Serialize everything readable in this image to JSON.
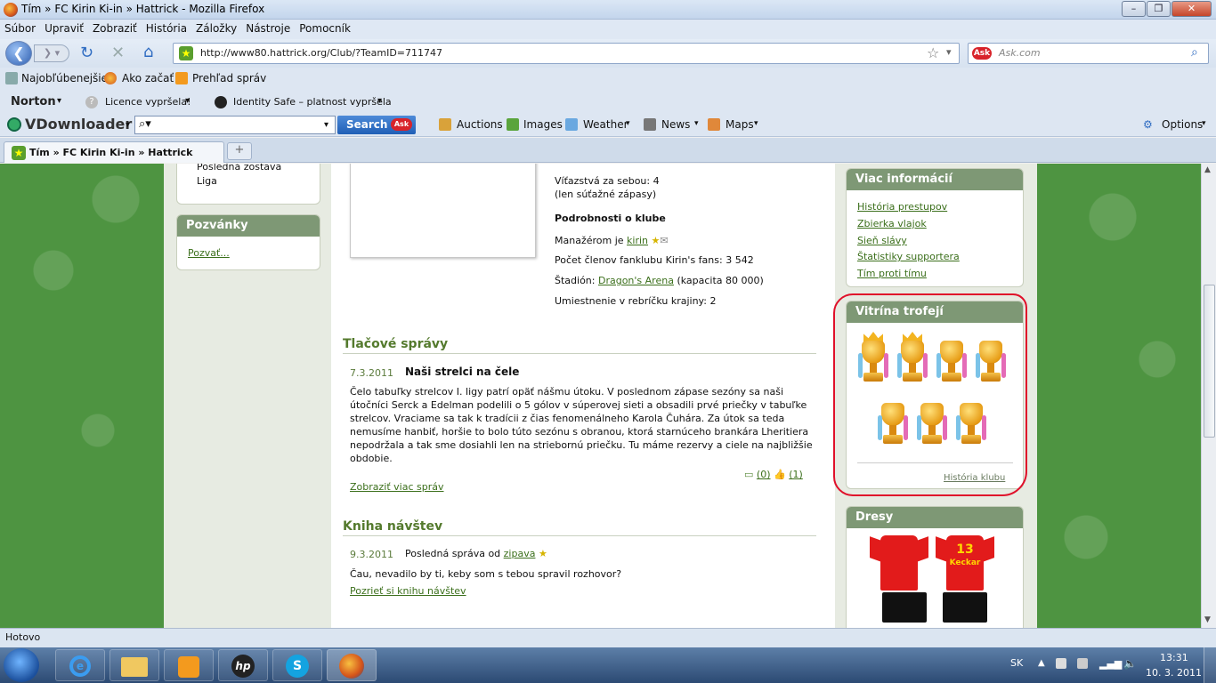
{
  "window": {
    "title": "Tím » FC Kirin Ki-in » Hattrick - Mozilla Firefox"
  },
  "menu": [
    "Súbor",
    "Upraviť",
    "Zobraziť",
    "História",
    "Záložky",
    "Nástroje",
    "Pomocník"
  ],
  "nav": {
    "url": "http://www80.hattrick.org/Club/?TeamID=711747",
    "search_placeholder": "Ask.com"
  },
  "bookmarks": [
    {
      "label": "Najobľúbenejšie"
    },
    {
      "label": "Ako začať"
    },
    {
      "label": "Prehľad správ"
    }
  ],
  "norton": {
    "brand": "Norton",
    "licence": "Licence vypršela!",
    "identity": "Identity Safe – platnost vypršela"
  },
  "vdl": {
    "brand": "VDownloader",
    "search_btn": "Search",
    "items": [
      "Auctions",
      "Images",
      "Weather",
      "News",
      "Maps"
    ],
    "options": "Options"
  },
  "tab": {
    "label": "Tím » FC Kirin Ki-in » Hattrick"
  },
  "left": {
    "top_items": [
      "Posledná zostava",
      "Liga"
    ],
    "invites_title": "Pozvánky",
    "invite_link": "Pozvať..."
  },
  "club": {
    "wins_streak": "Víťazstvá za sebou: 4",
    "wins_note": "(len súťažné zápasy)",
    "details_title": "Podrobnosti o klube",
    "manager_prefix": "Manažérom je",
    "manager": "kirin",
    "fans": "Počet členov fanklubu Kirin's fans: 3 542",
    "stadium_prefix": "Štadión:",
    "stadium": "Dragon's Arena",
    "stadium_cap": "(kapacita 80 000)",
    "ranking": "Umiestnenie v rebríčku krajiny: 2"
  },
  "press": {
    "title": "Tlačové správy",
    "date": "7.3.2011",
    "headline": "Naši strelci na čele",
    "body": "Čelo tabuľky strelcov I. ligy patrí opäť nášmu útoku. V poslednom zápase sezóny sa naši útočníci Serck a Edelman podelili o 5 gólov v súperovej sieti a obsadili prvé priečky v tabuľke strelcov. Vraciame sa tak k tradícii z čias fenomenálneho Karola Čuhára. Za útok sa teda nemusíme hanbiť, horšie to bolo túto sezónu s obranou, ktorá starnúceho brankára Lheritiera nepodržala a tak sme dosiahli len na striebornú priečku. Tu máme rezervy a ciele na najbližšie obdobie.",
    "comments": "(0)",
    "likes": "(1)",
    "more": "Zobraziť viac správ"
  },
  "guestbook": {
    "title": "Kniha návštev",
    "date": "9.3.2011",
    "msg_prefix": "Posledná správa od",
    "user": "zipava",
    "message": "Čau, nevadilo by ti, keby som s tebou spravil rozhovor?",
    "more": "Pozrieť si knihu návštev"
  },
  "right": {
    "info_title": "Viac informácií",
    "info_links": [
      "História prestupov",
      "Zbierka vlajok",
      "Sieň slávy",
      "Štatistiky supportera",
      "Tím proti tímu"
    ],
    "trophy_title": "Vitrína trofejí",
    "trophy_link": "História klubu",
    "kits_title": "Dresy",
    "kit_number": "13",
    "kit_name": "Keckar"
  },
  "status": {
    "text": "Hotovo"
  },
  "taskbar": {
    "lang": "SK",
    "time": "13:31",
    "date": "10. 3. 2011"
  },
  "colors": {
    "header_green": "#7e9875",
    "link_green": "#3b6f1b",
    "highlight_red": "#e0102a"
  }
}
